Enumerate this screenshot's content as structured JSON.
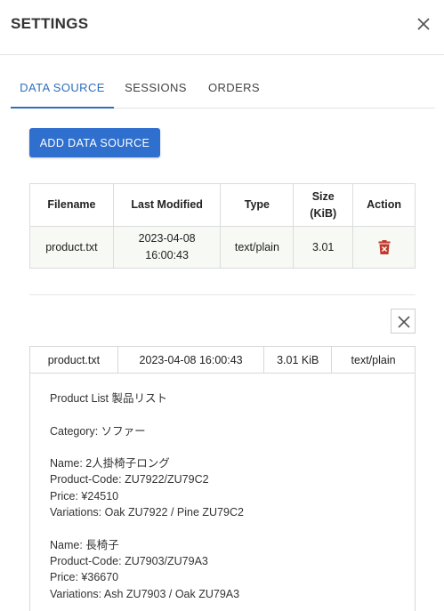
{
  "header": {
    "title": "SETTINGS"
  },
  "tabs": [
    {
      "label": "DATA SOURCE",
      "active": true
    },
    {
      "label": "SESSIONS",
      "active": false
    },
    {
      "label": "ORDERS",
      "active": false
    }
  ],
  "add_button": {
    "label": "ADD DATA SOURCE"
  },
  "files_table": {
    "headers": {
      "filename": "Filename",
      "last_modified": "Last Modified",
      "type": "Type",
      "size_line1": "Size",
      "size_line2": "(KiB)",
      "action": "Action"
    },
    "rows": [
      {
        "filename": "product.txt",
        "date": "2023-04-08",
        "time": "16:00:43",
        "type": "text/plain",
        "size": "3.01"
      }
    ]
  },
  "preview": {
    "filename": "product.txt",
    "modified": "2023-04-08 16:00:43",
    "size": "3.01 KiB",
    "type": "text/plain",
    "lines": [
      "Product List 製品リスト",
      "",
      "Category: ソファー",
      "",
      "Name: 2人掛椅子ロング",
      "Product-Code: ZU7922/ZU79C2",
      "Price: ¥24510",
      "Variations: Oak ZU7922 / Pine ZU79C2",
      "",
      "Name: 長椅子",
      "Product-Code: ZU7903/ZU79A3",
      "Price: ¥36670",
      "Variations: Ash ZU7903 / Oak ZU79A3"
    ]
  },
  "colors": {
    "accent": "#2f6fbf",
    "button": "#2f6fce",
    "delete": "#c0392b",
    "row_bg": "#f6f9f4"
  },
  "icons": {
    "close": "close-icon",
    "delete": "trash-icon",
    "preview_close": "close-icon"
  }
}
